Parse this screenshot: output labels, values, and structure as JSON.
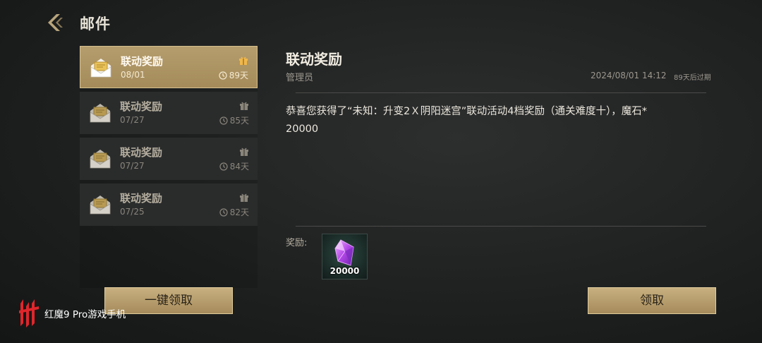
{
  "header": {
    "title": "邮件"
  },
  "mail_list": [
    {
      "title": "联动奖励",
      "date": "08/01",
      "expire": "89天",
      "selected": true
    },
    {
      "title": "联动奖励",
      "date": "07/27",
      "expire": "85天",
      "selected": false
    },
    {
      "title": "联动奖励",
      "date": "07/27",
      "expire": "84天",
      "selected": false
    },
    {
      "title": "联动奖励",
      "date": "07/25",
      "expire": "82天",
      "selected": false
    }
  ],
  "detail": {
    "title": "联动奖励",
    "sender": "管理员",
    "datetime": "2024/08/01 14:12",
    "expire_note": "89天后过期",
    "body_line1": "恭喜您获得了“未知：升变2Ｘ阴阳迷宫”联动活动4档奖励（通关难度十），魔石*",
    "body_line2": "20000",
    "reward_label": "奖励:",
    "reward_item": {
      "icon": "magic-stone-icon",
      "quantity": "20000"
    }
  },
  "buttons": {
    "claim_all": "一键领取",
    "claim": "领取"
  },
  "watermark": {
    "text": "红魔9 Pro游戏手机"
  },
  "colors": {
    "accent_gold": "#b59d6d",
    "background": "#1f2121",
    "gift_selected": "#f0b84a"
  }
}
